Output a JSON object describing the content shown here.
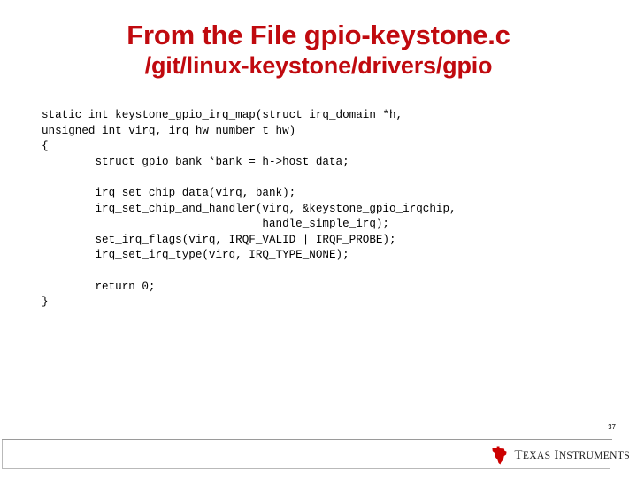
{
  "slide": {
    "title": "From the File gpio-keystone.c",
    "subtitle": "/git/linux-keystone/drivers/gpio",
    "title_color": "#C00A0F",
    "number": "37"
  },
  "code": {
    "language": "c",
    "lines": [
      "static int keystone_gpio_irq_map(struct irq_domain *h,",
      "unsigned int virq, irq_hw_number_t hw)",
      "{",
      "        struct gpio_bank *bank = h->host_data;",
      "",
      "        irq_set_chip_data(virq, bank);",
      "        irq_set_chip_and_handler(virq, &keystone_gpio_irqchip,",
      "                                 handle_simple_irq);",
      "        set_irq_flags(virq, IRQF_VALID | IRQF_PROBE);",
      "        irq_set_irq_type(virq, IRQ_TYPE_NONE);",
      "",
      "        return 0;",
      "}"
    ]
  },
  "footer": {
    "logo_text_texas": "T",
    "logo_text_texas_rest": "EXAS",
    "logo_text_instruments": "I",
    "logo_text_instruments_rest": "NSTRUMENTS",
    "logo_name": "Texas Instruments",
    "logo_color": "#CC0000"
  }
}
